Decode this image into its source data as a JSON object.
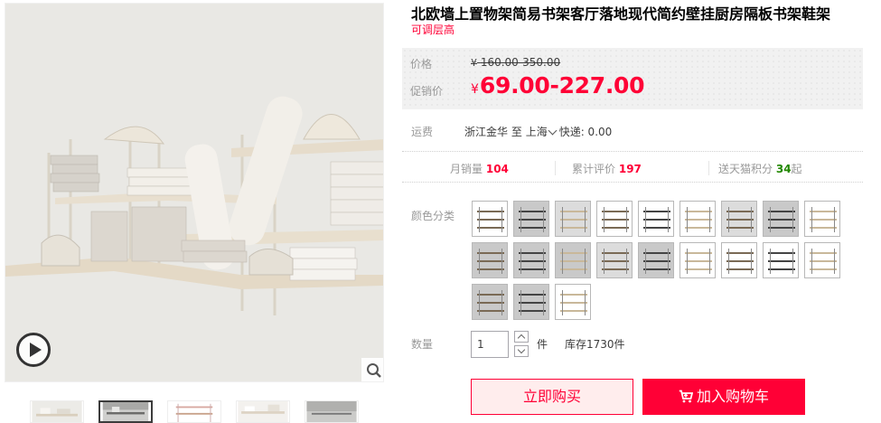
{
  "product": {
    "title": "北欧墙上置物架简易书架客厅落地现代简约壁挂厨房隔板书架鞋架",
    "subtitle": "可调层高"
  },
  "gallery": {
    "main_image": "wall-shelf-with-books-photo",
    "play_icon": "play-icon",
    "zoom_icon": "zoom-icon",
    "thumbnails": [
      "thumb-1",
      "thumb-2",
      "thumb-3",
      "thumb-4",
      "thumb-5"
    ],
    "active_thumbnail": 2
  },
  "price": {
    "label": "价格",
    "currency": "¥",
    "original": "160.00-350.00",
    "promo_label": "促销价",
    "promo": "69.00-227.00"
  },
  "shipping": {
    "label": "运费",
    "from": "浙江金华",
    "to_word": "至",
    "destination": "上海",
    "method": "快递: 0.00"
  },
  "stats": {
    "monthly_sales_label": "月销量",
    "monthly_sales": "104",
    "reviews_label": "累计评价",
    "reviews": "197",
    "points_label": "送天猫积分",
    "points": "34",
    "points_suffix": "起"
  },
  "color": {
    "label": "颜色分类",
    "options_count": 21
  },
  "quantity": {
    "label": "数量",
    "value": "1",
    "unit": "件",
    "stock": "库存1730件"
  },
  "actions": {
    "buy_now": "立即购买",
    "add_to_cart": "加入购物车"
  },
  "colors": {
    "accent": "#ff0036",
    "buy_bg": "#ffeded",
    "points": "#228800"
  }
}
